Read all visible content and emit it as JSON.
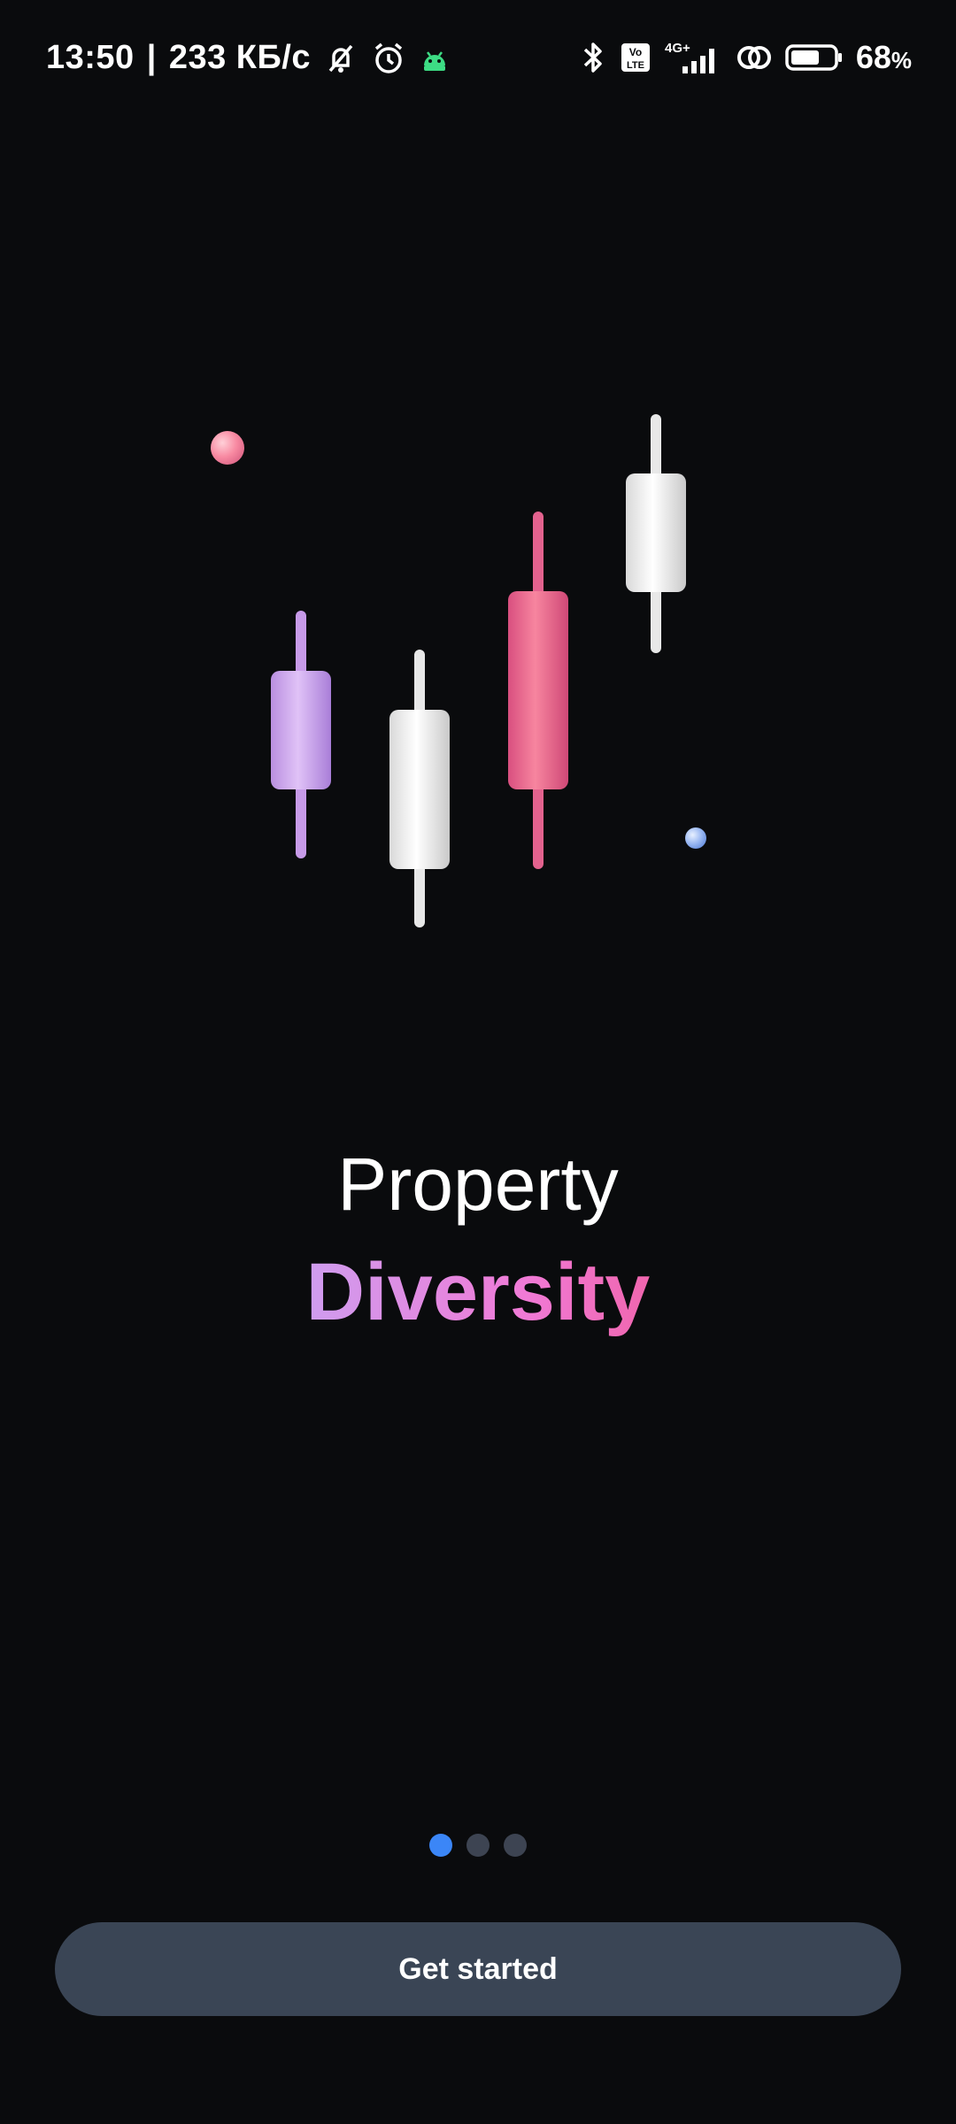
{
  "status_bar": {
    "time": "13:50",
    "separator": "|",
    "speed": "233 КБ/с",
    "network": "4G+",
    "volte": "Vo LTE",
    "battery_percent": "68",
    "battery_unit": "%",
    "battery_level": 0.68,
    "icons": [
      "mute-icon",
      "alarm-icon",
      "android-icon",
      "bluetooth-icon",
      "volte-icon",
      "signal-icon",
      "link-icon",
      "battery-icon"
    ]
  },
  "onboarding": {
    "title_line1": "Property",
    "title_line2": "Diversity"
  },
  "pager": {
    "pages": 3,
    "active_index": 0
  },
  "actions": {
    "get_started_label": "Get started"
  },
  "colors": {
    "background": "#0a0b0d",
    "accent": "#3b86f7",
    "button": "#3a4555",
    "candle_purple": "#c79ae8",
    "candle_white": "#f2f2f2",
    "candle_pink": "#e85a8a"
  }
}
